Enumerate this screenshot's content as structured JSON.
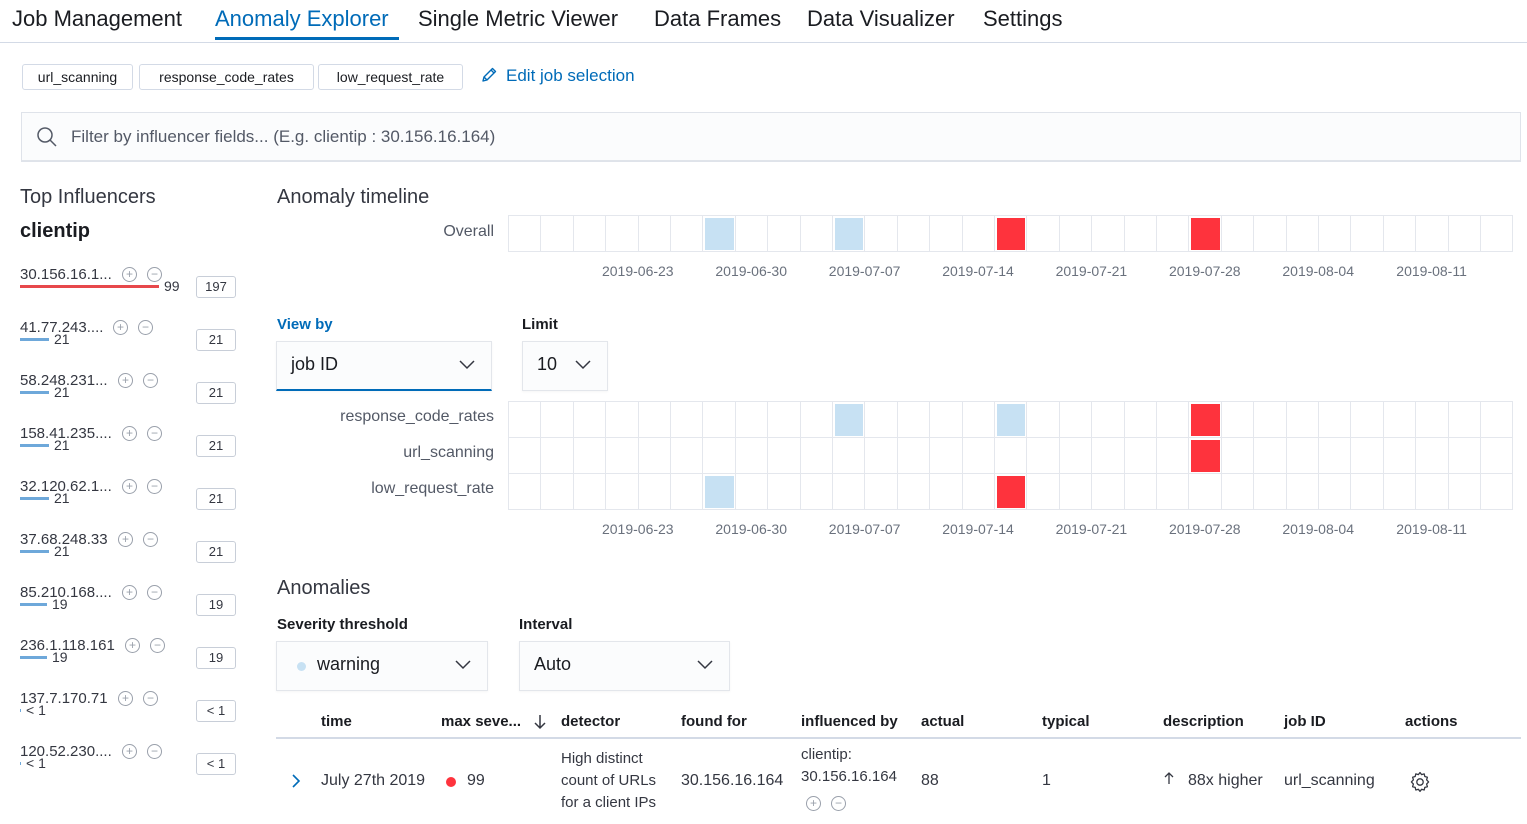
{
  "nav": {
    "tabs": [
      {
        "label": "Job Management"
      },
      {
        "label": "Anomaly Explorer",
        "active": true
      },
      {
        "label": "Single Metric Viewer"
      },
      {
        "label": "Data Frames"
      },
      {
        "label": "Data Visualizer"
      },
      {
        "label": "Settings"
      }
    ]
  },
  "jobs": {
    "selected": [
      "url_scanning",
      "response_code_rates",
      "low_request_rate"
    ],
    "edit_label": "Edit job selection"
  },
  "search": {
    "placeholder": "Filter by influencer fields... (E.g. clientip : 30.156.16.164)",
    "value": ""
  },
  "influencers": {
    "title": "Top Influencers",
    "field": "clientip",
    "items": [
      {
        "name": "30.156.16.1...",
        "score": "99",
        "total": "197",
        "severity": "critical"
      },
      {
        "name": "41.77.243....",
        "score": "21",
        "total": "21",
        "severity": "low"
      },
      {
        "name": "58.248.231...",
        "score": "21",
        "total": "21",
        "severity": "low"
      },
      {
        "name": "158.41.235....",
        "score": "21",
        "total": "21",
        "severity": "low"
      },
      {
        "name": "32.120.62.1...",
        "score": "21",
        "total": "21",
        "severity": "low"
      },
      {
        "name": "37.68.248.33",
        "score": "21",
        "total": "21",
        "severity": "low"
      },
      {
        "name": "85.210.168....",
        "score": "19",
        "total": "19",
        "severity": "low"
      },
      {
        "name": "236.1.118.161",
        "score": "19",
        "total": "19",
        "severity": "low"
      },
      {
        "name": "137.7.170.71",
        "score": "< 1",
        "total": "< 1",
        "severity": "none"
      },
      {
        "name": "120.52.230....",
        "score": "< 1",
        "total": "< 1",
        "severity": "none"
      }
    ]
  },
  "timeline": {
    "title": "Anomaly timeline",
    "overall_label": "Overall",
    "overall_cells": [
      {
        "index": 6,
        "severity": "low"
      },
      {
        "index": 10,
        "severity": "low"
      },
      {
        "index": 15,
        "severity": "critical"
      },
      {
        "index": 21,
        "severity": "critical"
      }
    ],
    "x_ticks": [
      "2019-06-23",
      "2019-06-30",
      "2019-07-07",
      "2019-07-14",
      "2019-07-21",
      "2019-07-28",
      "2019-08-04",
      "2019-08-11"
    ],
    "view_by": {
      "label": "View by",
      "value": "job ID"
    },
    "limit": {
      "label": "Limit",
      "value": "10"
    },
    "lanes": [
      {
        "label": "response_code_rates",
        "cells": [
          {
            "index": 10,
            "severity": "low"
          },
          {
            "index": 15,
            "severity": "low"
          },
          {
            "index": 21,
            "severity": "critical"
          }
        ]
      },
      {
        "label": "url_scanning",
        "cells": [
          {
            "index": 21,
            "severity": "critical"
          }
        ]
      },
      {
        "label": "low_request_rate",
        "cells": [
          {
            "index": 6,
            "severity": "low"
          },
          {
            "index": 15,
            "severity": "critical"
          }
        ]
      }
    ]
  },
  "anomalies": {
    "title": "Anomalies",
    "severity_threshold": {
      "label": "Severity threshold",
      "value": "warning"
    },
    "interval": {
      "label": "Interval",
      "value": "Auto"
    },
    "columns": [
      "time",
      "max seve...",
      "detector",
      "found for",
      "influenced by",
      "actual",
      "typical",
      "description",
      "job ID",
      "actions"
    ],
    "rows": [
      {
        "time": "July 27th 2019",
        "max_severity": "99",
        "detector": [
          "High distinct",
          "count of URLs",
          "for a client IPs"
        ],
        "found_for": "30.156.16.164",
        "influenced_by": [
          "clientip:",
          "30.156.16.164"
        ],
        "actual": "88",
        "typical": "1",
        "description": "88x higher",
        "job_id": "url_scanning"
      }
    ]
  },
  "colors": {
    "accent": "#006bb8",
    "critical": "#fe333d",
    "low": "#c7e1f3",
    "warning_dot": "#c7e1f3",
    "influencer_low_bar": "#6ea8da",
    "influencer_critical_bar": "#e7484b"
  }
}
